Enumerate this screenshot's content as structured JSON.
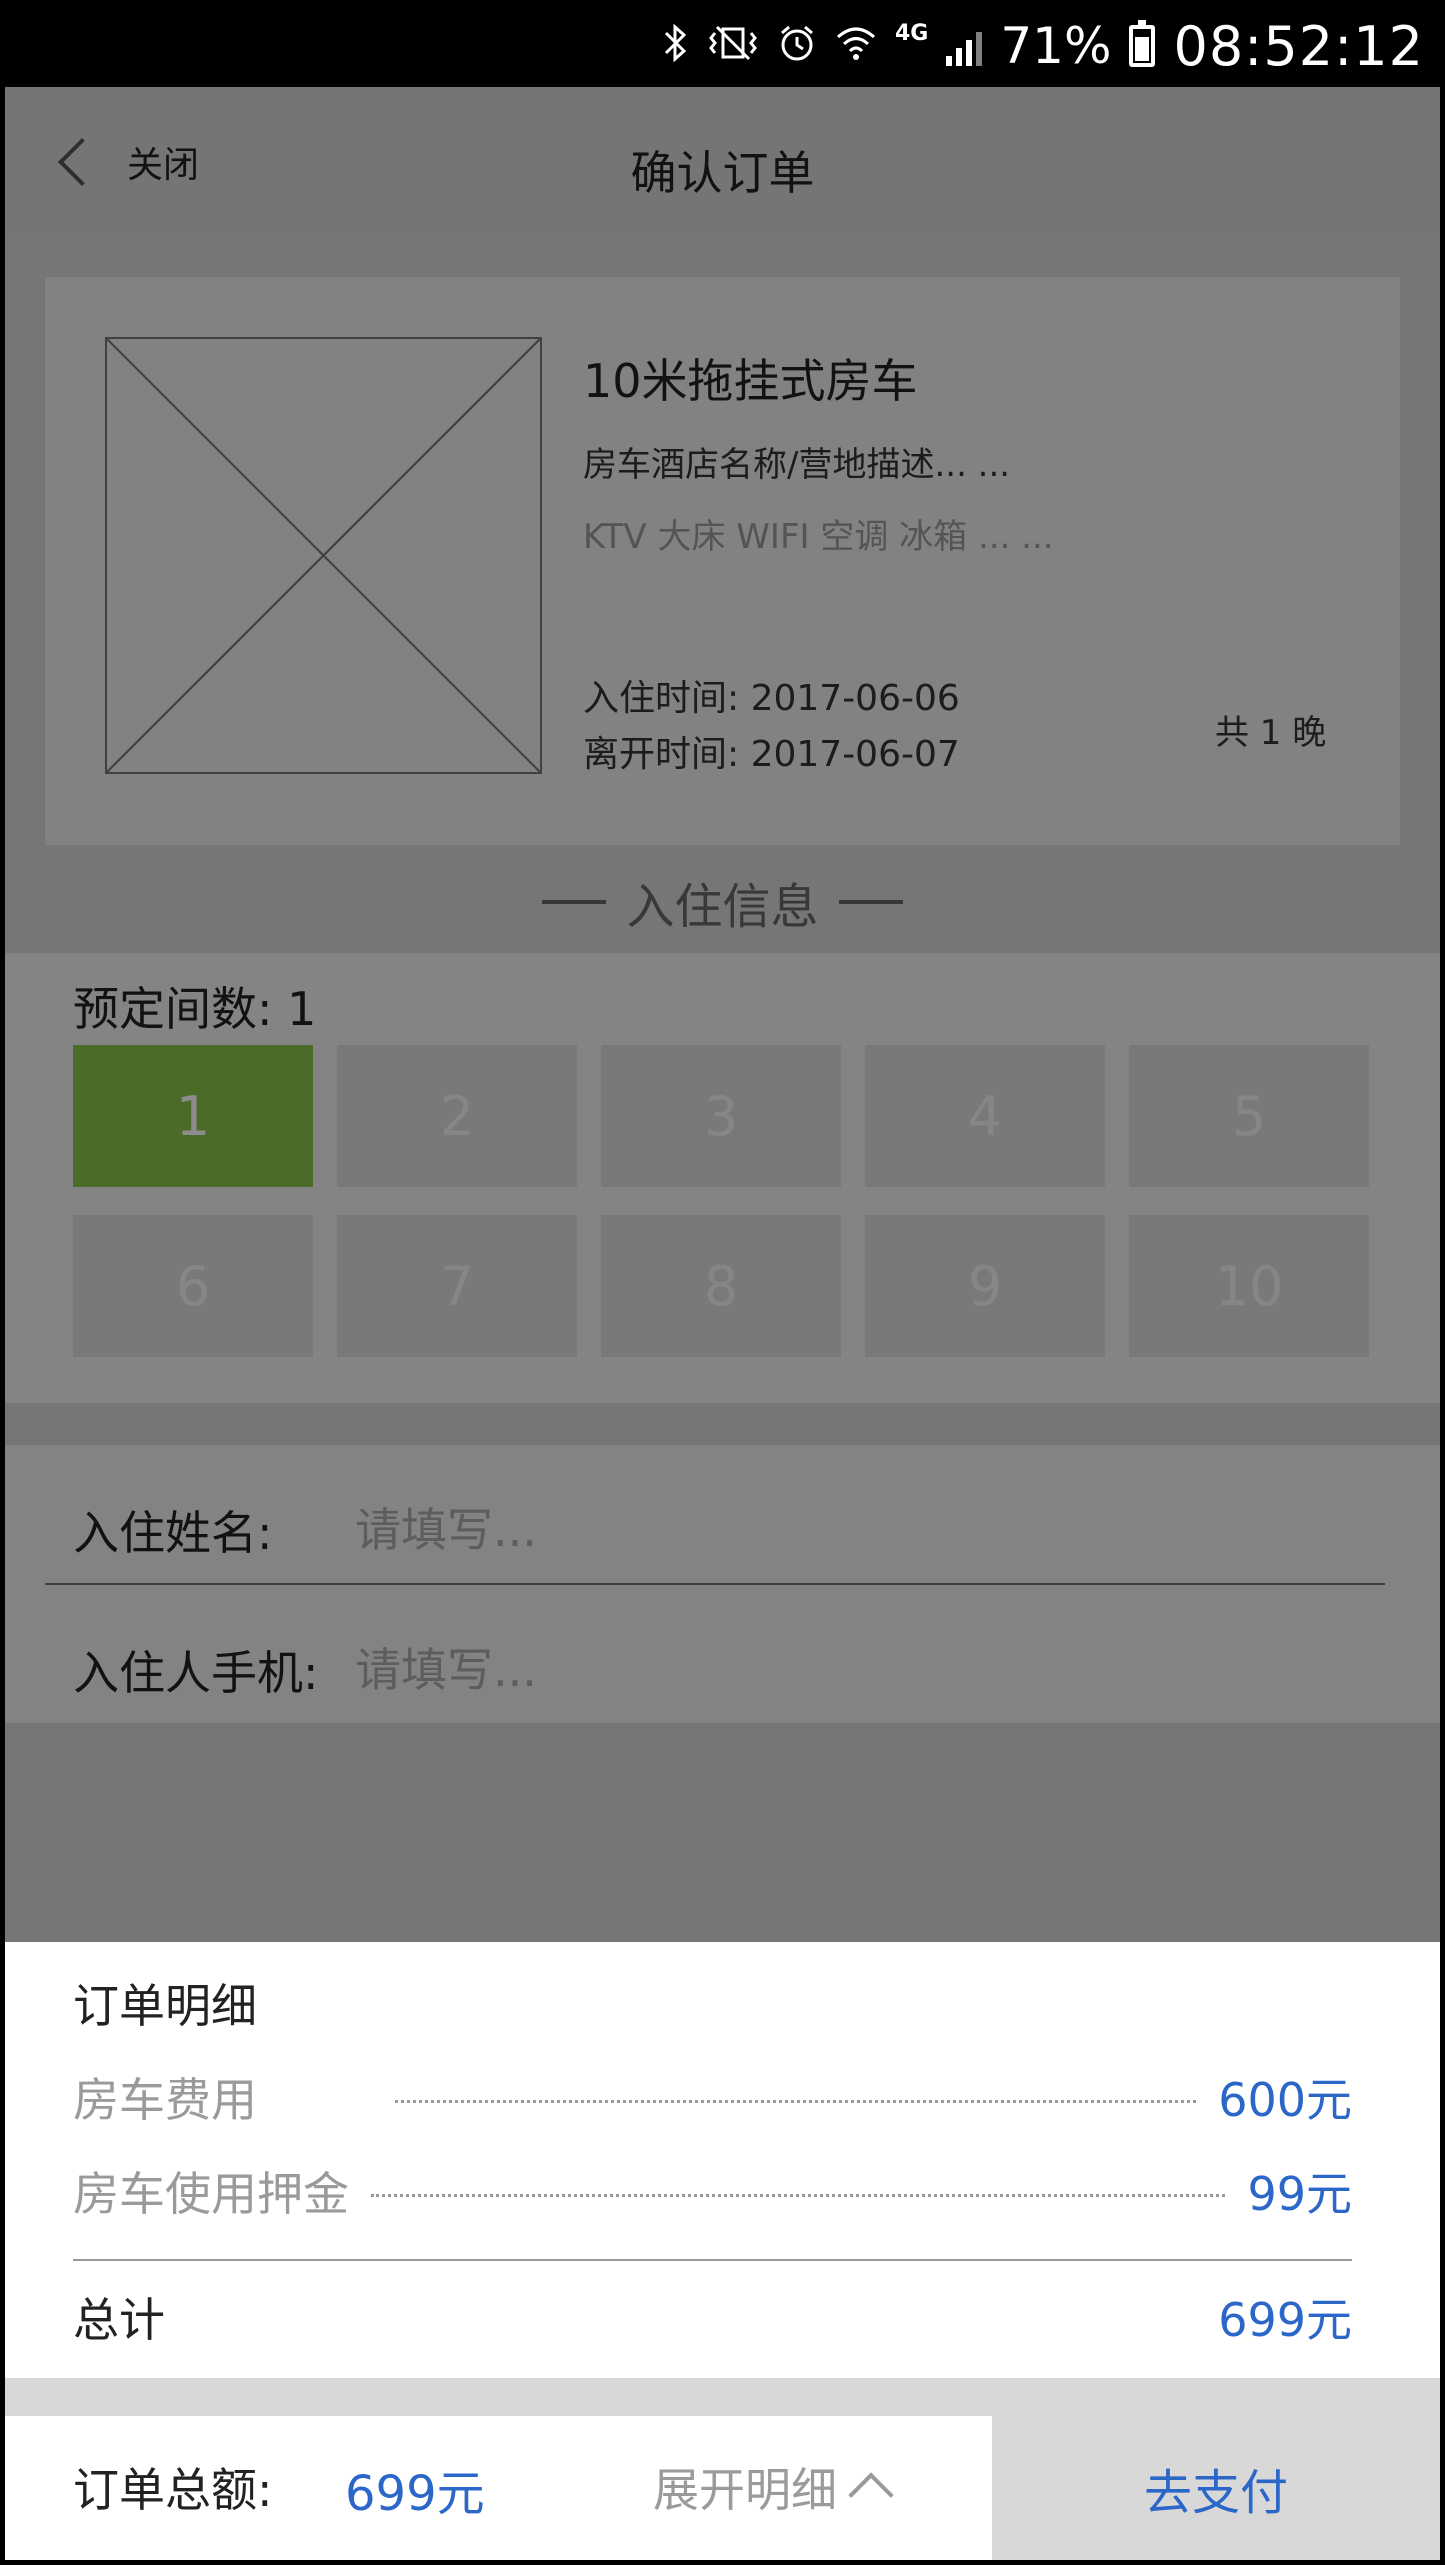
{
  "status_bar": {
    "icons": [
      "bluetooth-icon",
      "vibrate-icon",
      "alarm-icon",
      "wifi-icon",
      "4g-icon",
      "signal-icon",
      "battery-icon"
    ],
    "network": "4G",
    "battery": "71%",
    "time": "08:52:12"
  },
  "nav": {
    "back_label": "关闭",
    "title": "确认订单"
  },
  "product": {
    "name": "10米拖挂式房车",
    "description": "房车酒店名称/营地描述... ...",
    "tags": "KTV 大床 WIFI 空调 冰箱 ... ...",
    "checkin": "入住时间: 2017-06-06",
    "checkout": "离开时间: 2017-06-07",
    "nights": "共 1 晚"
  },
  "section_title": "入住信息",
  "rooms": {
    "label": "预定间数: 1",
    "options": [
      "1",
      "2",
      "3",
      "4",
      "5",
      "6",
      "7",
      "8",
      "9",
      "10"
    ],
    "selected": "1"
  },
  "form": {
    "name_label": "入住姓名:",
    "name_placeholder": "请填写...",
    "phone_label": "入住人手机:",
    "phone_placeholder": "请填写..."
  },
  "order_detail": {
    "title": "订单明细",
    "fees": [
      {
        "label": "房车费用",
        "value": "600元"
      },
      {
        "label": "房车使用押金",
        "value": "99元"
      }
    ],
    "total_label": "总计",
    "total_value": "699元"
  },
  "bottom_bar": {
    "total_label": "订单总额:",
    "total_amount": "699元",
    "expand_label": "展开明细",
    "pay_label": "去支付"
  },
  "colors": {
    "accent": "#2b66c9",
    "selected_room": "#8bc34a"
  }
}
